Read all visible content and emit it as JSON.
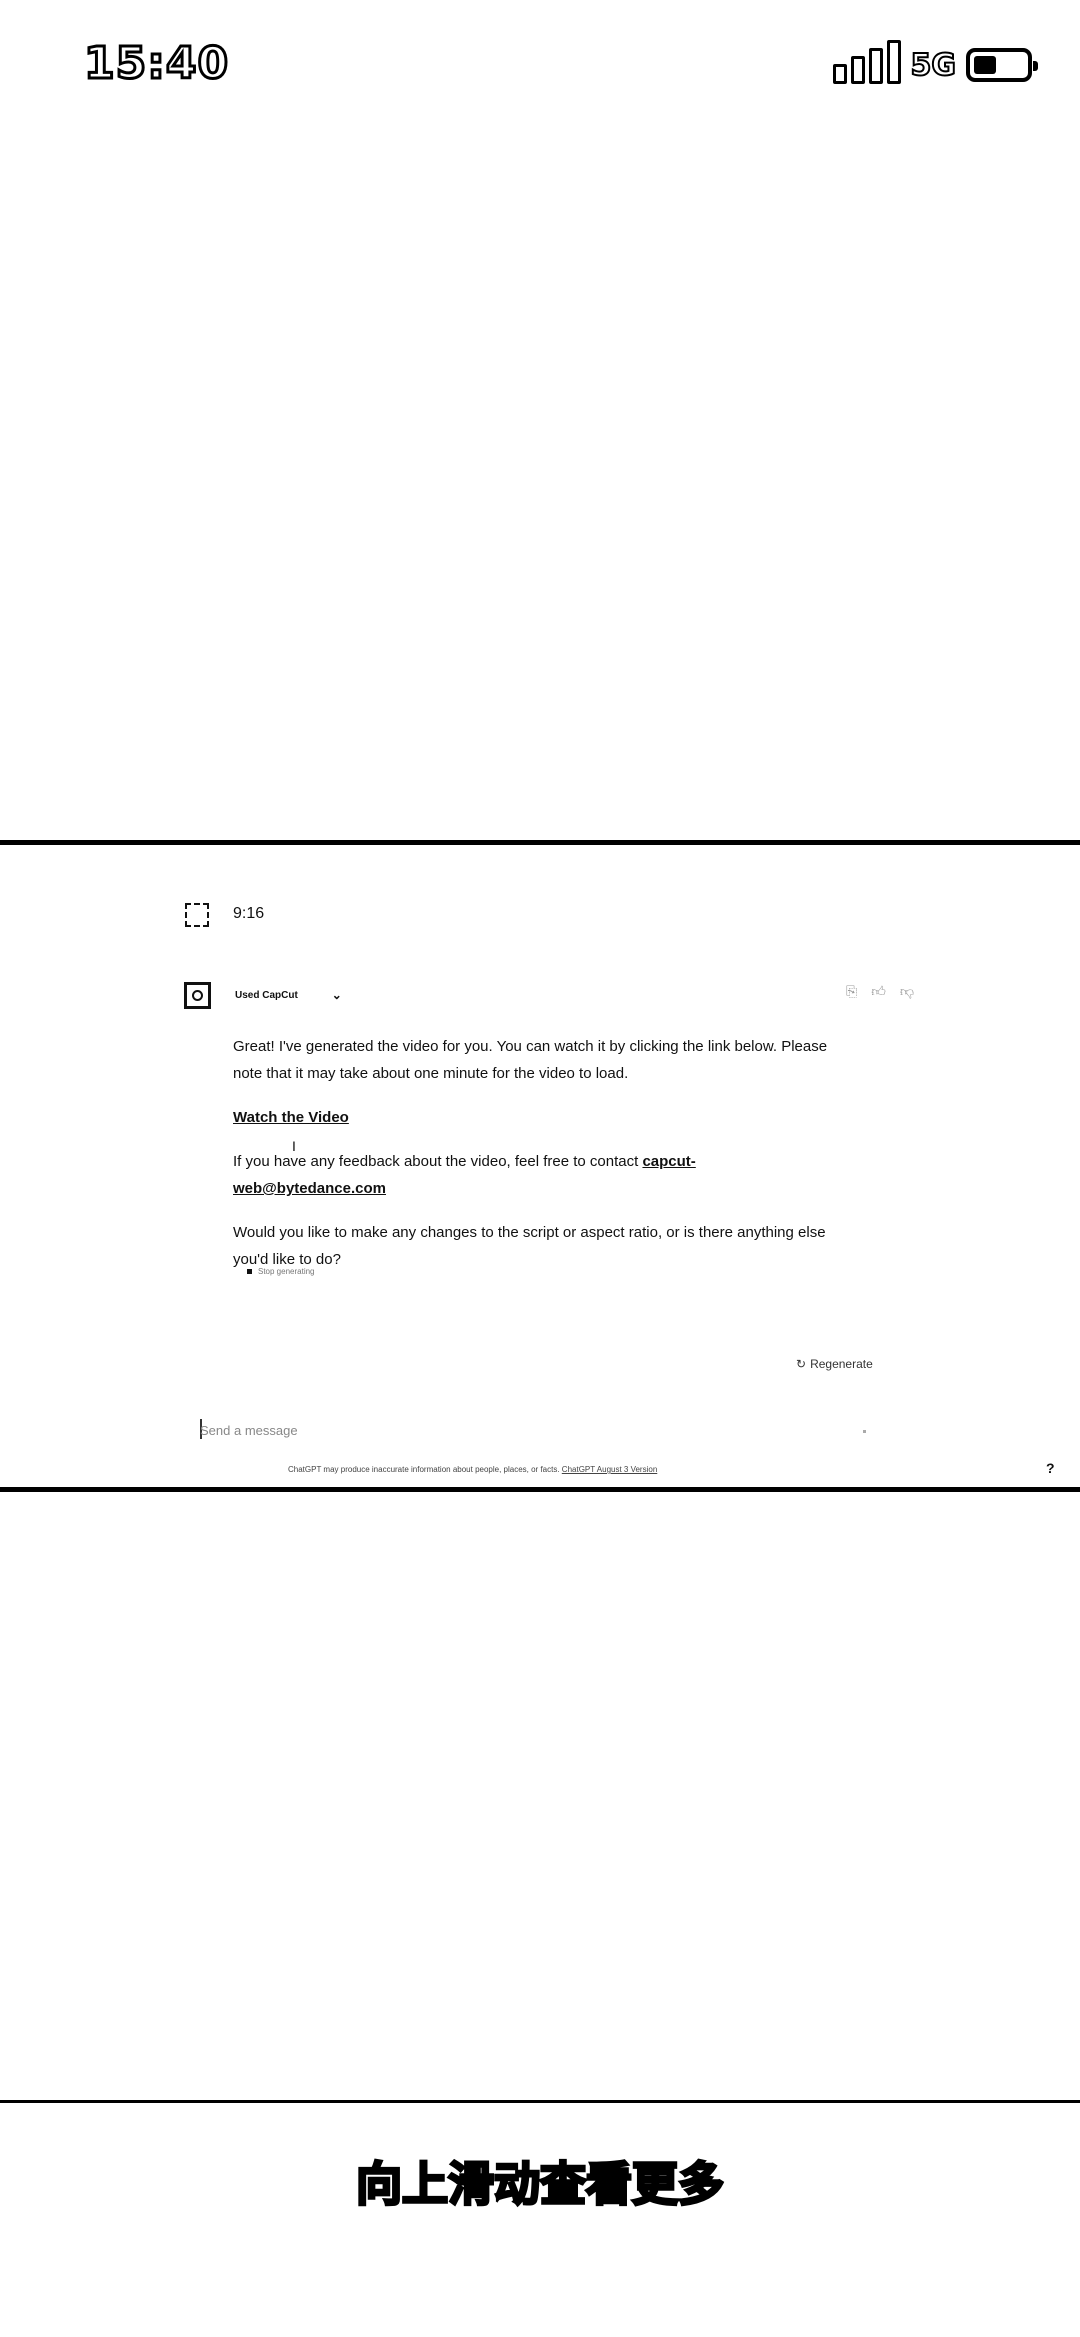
{
  "status_bar": {
    "time": "15:40",
    "network": "5G",
    "signal_icon": "signal-bars-icon",
    "battery_icon": "battery-icon",
    "battery_level": 0.3
  },
  "chat": {
    "user_message": "9:16",
    "plugin_label": "Used CapCut",
    "paragraph_1": "Great! I've generated the video for you. You can watch it by clicking the link below. Please note that it may take about one minute for the video to load.",
    "watch_link": "Watch the Video",
    "feedback_prefix": "If you have any feedback about the video, feel free to contact",
    "feedback_email": "capcut-web@bytedance.com",
    "paragraph_3": "Would you like to make any changes to the script or aspect ratio, or is there anything else you'd like to do?",
    "small_note": "Stop generating",
    "regenerate_label": "Regenerate",
    "input_placeholder": "Send a message",
    "disclaimer_text": "ChatGPT may produce inaccurate information about people, places, or facts.",
    "disclaimer_link": "ChatGPT August 3 Version",
    "help_label": "?",
    "action_icons": [
      "copy-icon",
      "thumbs-up-icon",
      "thumbs-down-icon"
    ]
  },
  "caption": "向上滑动查看更多"
}
